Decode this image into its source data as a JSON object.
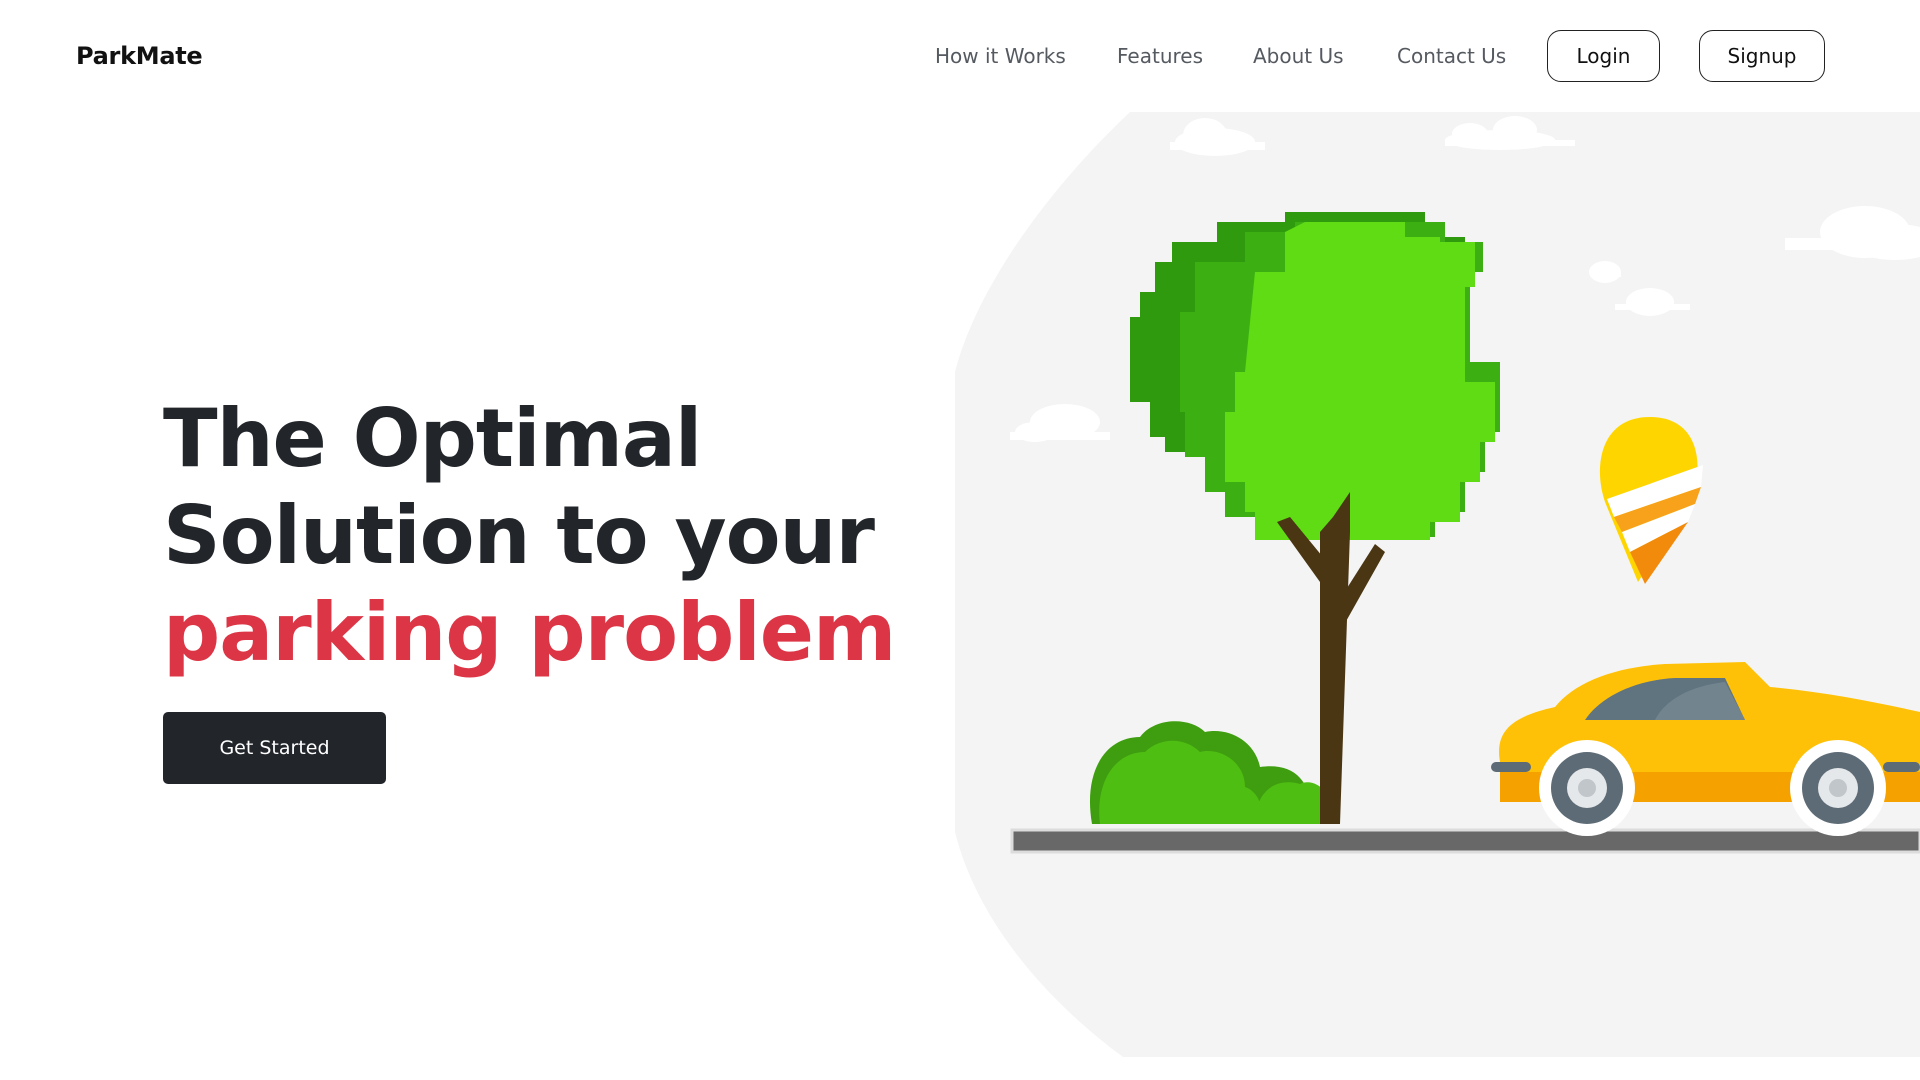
{
  "brand": {
    "name": "ParkMate"
  },
  "nav": {
    "links": [
      "How it Works",
      "Features",
      "About Us",
      "Contact Us"
    ],
    "login_label": "Login",
    "signup_label": "Signup"
  },
  "hero": {
    "line1": "The Optimal",
    "line2": "Solution to your",
    "line3": "parking problem",
    "cta_label": "Get Started"
  },
  "colors": {
    "dark": "#22262b",
    "accent": "#dc3545",
    "illustration_bg": "#f4f4f4",
    "tree_light": "#5fdc14",
    "tree_dark": "#2f9a0e",
    "car": "#ffc107",
    "pin": "#ffd500"
  },
  "icons": {
    "illustration": "car-parking-illustration"
  }
}
